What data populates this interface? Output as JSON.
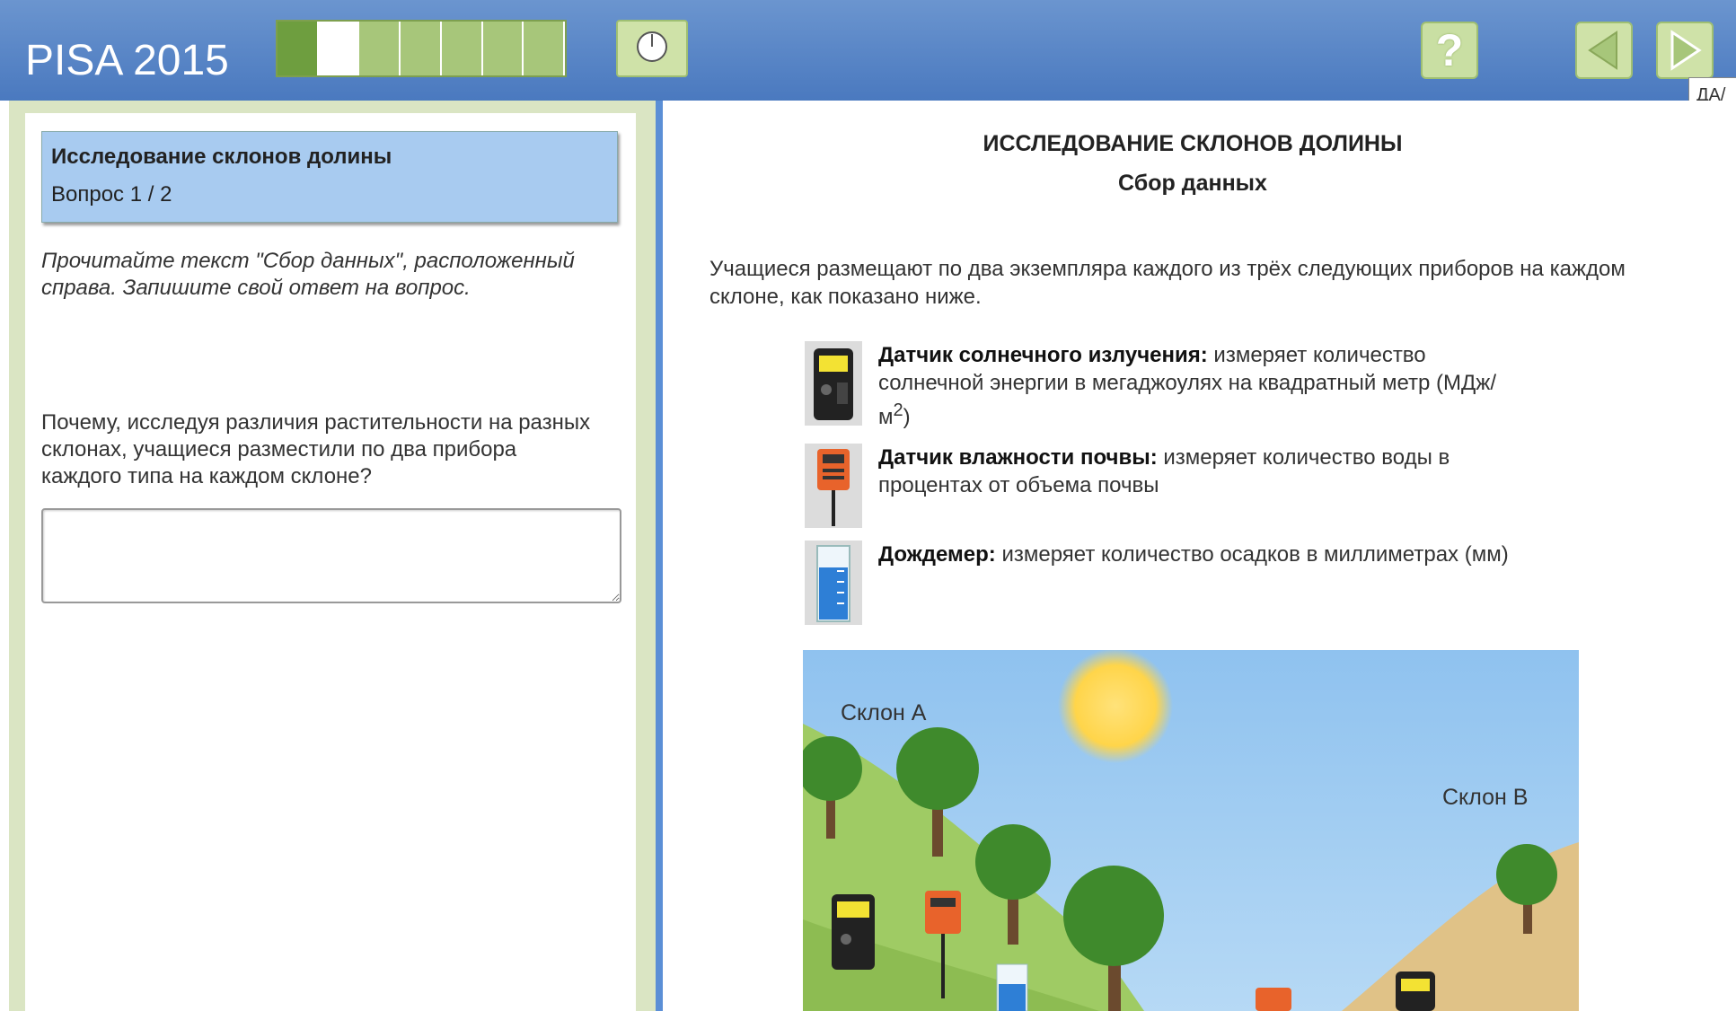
{
  "header": {
    "brand": "PISA 2015",
    "progress_segments": 7,
    "progress_current": 2,
    "tooltip": "ДА/"
  },
  "left": {
    "unit_title": "Исследование склонов долины",
    "question_counter": "Вопрос 1 / 2",
    "instruction": "Прочитайте текст \"Сбор данных\", расположенный справа. Запишите свой ответ на вопрос.",
    "question": "Почему, исследуя различия растительности на разных склонах, учащиеся разместили по два прибора каждого типа на каждом склоне?",
    "answer_value": ""
  },
  "right": {
    "title": "ИССЛЕДОВАНИЕ СКЛОНОВ ДОЛИНЫ",
    "subtitle": "Сбор данных",
    "intro": "Учащиеся размещают по два экземпляра каждого из трёх следующих приборов на каждом склоне, как показано ниже.",
    "devices": [
      {
        "name": "Датчик солнечного излучения:",
        "desc": " измеряет количество солнечной энергии в мегаджоулях на квадратный метр (МДж/м",
        "sup": "2",
        "tail": ")"
      },
      {
        "name": "Датчик влажности почвы:",
        "desc": " измеряет количество воды в процентах от объема почвы"
      },
      {
        "name": "Дождемер:",
        "desc": " измеряет количество осадков в миллиметрах (мм)"
      }
    ],
    "scene": {
      "slope_a": "Склон A",
      "slope_b": "Склон B"
    }
  },
  "colors": {
    "header_top": "#6b95cf",
    "header_bottom": "#4a79bf",
    "progress_done": "#6e9e3f",
    "progress_current": "#ffffff",
    "progress_pending": "#a7c67a",
    "pane_green": "#dae5c3",
    "unit_box": "#a8cbf0"
  }
}
